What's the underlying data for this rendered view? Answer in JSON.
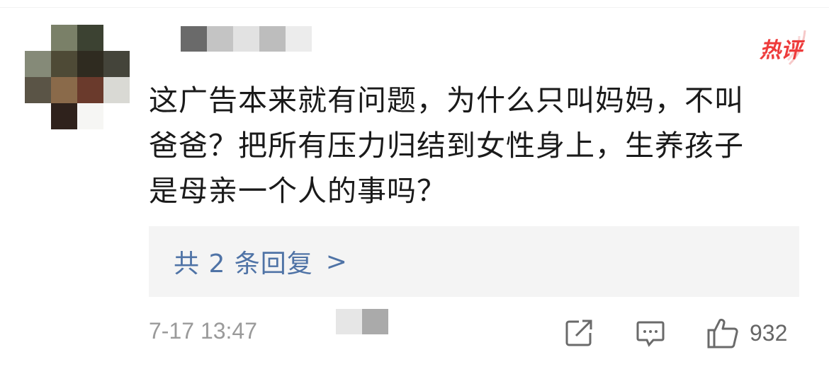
{
  "badge": {
    "label": "热评",
    "color": "#ee3b3b"
  },
  "comment": {
    "line1": "这广告本来就有问题，为什么只叫妈妈，不叫",
    "line2": "爸爸？把所有压力归结到女性身上，生养孩子",
    "line3": "是母亲一个人的事吗？"
  },
  "replies": {
    "label": "共 2 条回复",
    "chevron": ">"
  },
  "footer": {
    "timestamp": "7-17 13:47",
    "like_count": "932"
  },
  "icons": {
    "share": "share-icon",
    "comment": "comment-icon",
    "like": "thumbs-up-icon"
  },
  "colors": {
    "link": "#4f73a6",
    "badge_red": "#ee3b3b",
    "meta_gray": "#9a9a9a",
    "reply_bg": "#f4f4f4"
  }
}
